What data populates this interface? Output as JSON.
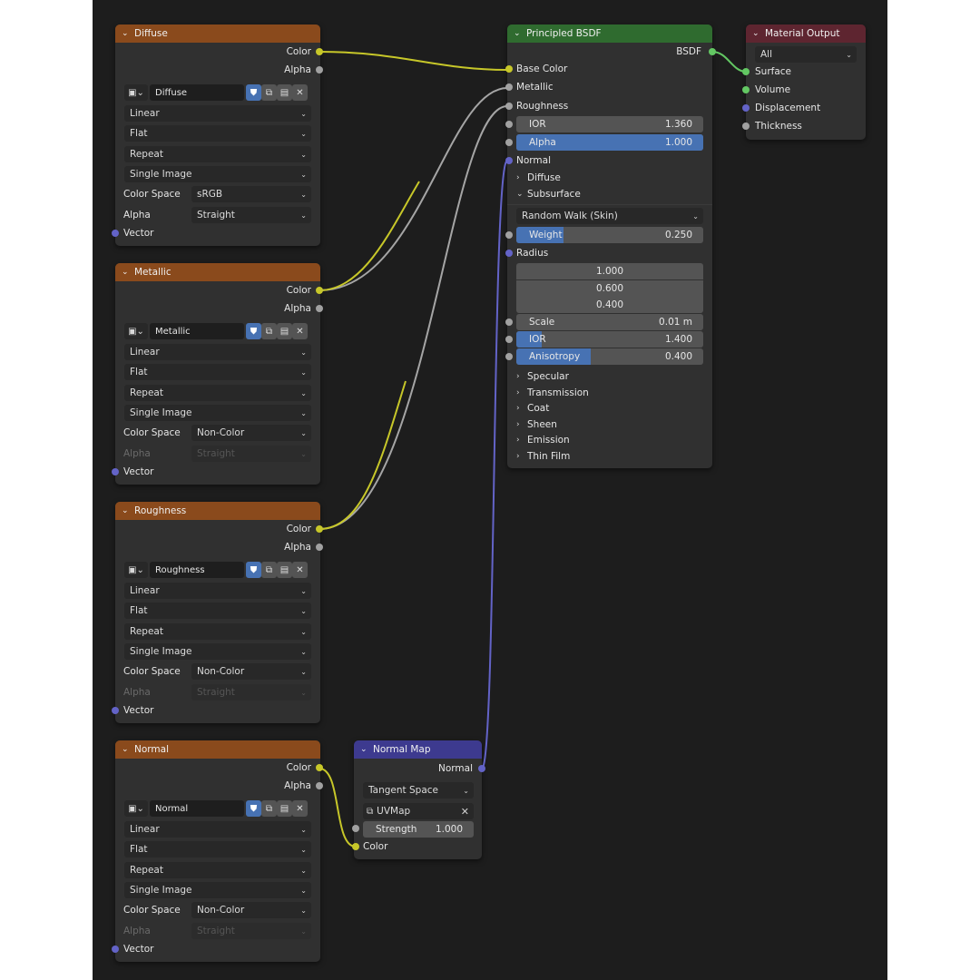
{
  "colors": {
    "editor_bg": "#1d1d1d",
    "node_bg": "#303030",
    "texture_header": "#8a4a1c",
    "shader_header": "#2f6b2f",
    "output_header": "#5e2530",
    "vector_header": "#3d3a8f",
    "socket_color": "#c7c729",
    "socket_float": "#a1a1a1",
    "socket_vector": "#6363c7",
    "socket_shader": "#63c763",
    "slider_fill": "#4772b3"
  },
  "texture_nodes": [
    {
      "title": "Diffuse",
      "out_color": "Color",
      "out_alpha": "Alpha",
      "image_name": "Diffuse",
      "interpolation": "Linear",
      "projection": "Flat",
      "extension": "Repeat",
      "source": "Single Image",
      "color_space_label": "Color Space",
      "color_space": "sRGB",
      "alpha_label": "Alpha",
      "alpha_mode": "Straight",
      "alpha_disabled": false,
      "input_vector": "Vector"
    },
    {
      "title": "Metallic",
      "out_color": "Color",
      "out_alpha": "Alpha",
      "image_name": "Metallic",
      "interpolation": "Linear",
      "projection": "Flat",
      "extension": "Repeat",
      "source": "Single Image",
      "color_space_label": "Color Space",
      "color_space": "Non-Color",
      "alpha_label": "Alpha",
      "alpha_mode": "Straight",
      "alpha_disabled": true,
      "input_vector": "Vector"
    },
    {
      "title": "Roughness",
      "out_color": "Color",
      "out_alpha": "Alpha",
      "image_name": "Roughness",
      "interpolation": "Linear",
      "projection": "Flat",
      "extension": "Repeat",
      "source": "Single Image",
      "color_space_label": "Color Space",
      "color_space": "Non-Color",
      "alpha_label": "Alpha",
      "alpha_mode": "Straight",
      "alpha_disabled": true,
      "input_vector": "Vector"
    },
    {
      "title": "Normal",
      "out_color": "Color",
      "out_alpha": "Alpha",
      "image_name": "Normal",
      "interpolation": "Linear",
      "projection": "Flat",
      "extension": "Repeat",
      "source": "Single Image",
      "color_space_label": "Color Space",
      "color_space": "Non-Color",
      "alpha_label": "Alpha",
      "alpha_mode": "Straight",
      "alpha_disabled": true,
      "input_vector": "Vector"
    }
  ],
  "principled": {
    "title": "Principled BSDF",
    "out_bsdf": "BSDF",
    "base_color": "Base Color",
    "metallic": "Metallic",
    "roughness": "Roughness",
    "ior_label": "IOR",
    "ior_value": "1.360",
    "alpha_label": "Alpha",
    "alpha_value": "1.000",
    "alpha_fraction": 1.0,
    "normal": "Normal",
    "sec_diffuse": "Diffuse",
    "sec_subsurface": "Subsurface",
    "ss_method": "Random Walk (Skin)",
    "ss_weight_label": "Weight",
    "ss_weight_value": "0.250",
    "ss_weight_fraction": 0.25,
    "radius_label": "Radius",
    "radius_values": [
      "1.000",
      "0.600",
      "0.400"
    ],
    "scale_label": "Scale",
    "scale_value": "0.01 m",
    "ss_ior_label": "IOR",
    "ss_ior_value": "1.400",
    "anisotropy_label": "Anisotropy",
    "anisotropy_value": "0.400",
    "anisotropy_fraction": 0.4,
    "sec_specular": "Specular",
    "sec_transmission": "Transmission",
    "sec_coat": "Coat",
    "sec_sheen": "Sheen",
    "sec_emission": "Emission",
    "sec_thin_film": "Thin Film"
  },
  "material_output": {
    "title": "Material Output",
    "target": "All",
    "surface": "Surface",
    "volume": "Volume",
    "displacement": "Displacement",
    "thickness": "Thickness"
  },
  "normal_map": {
    "title": "Normal Map",
    "out_normal": "Normal",
    "space": "Tangent Space",
    "uv_map": "UVMap",
    "strength_label": "Strength",
    "strength_value": "1.000",
    "in_color": "Color"
  },
  "icons": {
    "collapse": "chevron-down-icon",
    "expand": "chevron-right-icon",
    "image": "image-icon",
    "fake_user": "shield-icon",
    "duplicate": "duplicate-icon",
    "open": "folder-icon",
    "unlink": "close-icon",
    "uv": "uv-icon"
  }
}
